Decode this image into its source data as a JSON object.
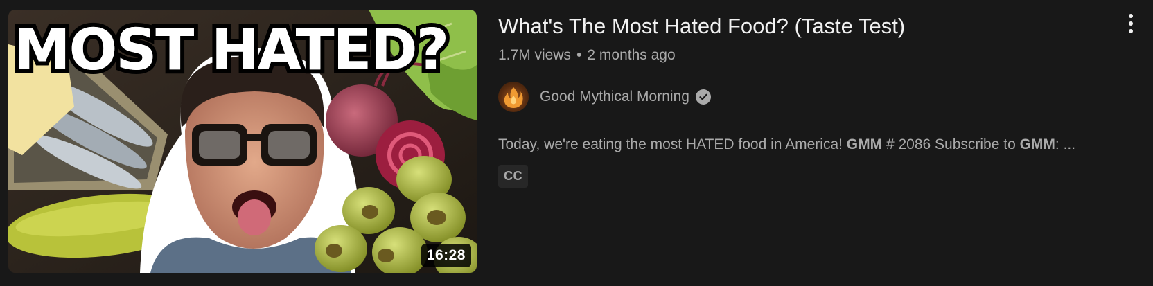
{
  "video": {
    "thumbnail": {
      "headline": "MOST HATED?",
      "duration": "16:28"
    },
    "title": "What's The Most Hated Food? (Taste Test)",
    "views": "1.7M views",
    "separator": "•",
    "published": "2 months ago",
    "channel": {
      "name": "Good Mythical Morning",
      "verified_icon": "checkmark-icon",
      "avatar_icon": "flame-logo-icon"
    },
    "description": {
      "part1": "Today, we're eating the most HATED food in America! ",
      "bold1": "GMM",
      "part2": " # 2086 Subscribe to ",
      "bold2": "GMM",
      "part3": ": ..."
    },
    "badge": "CC",
    "menu_icon": "more-vertical-icon"
  },
  "colors": {
    "background": "#181818",
    "title": "#f1f1f1",
    "secondary_text": "#aaaaaa",
    "badge_bg": "#272727"
  }
}
